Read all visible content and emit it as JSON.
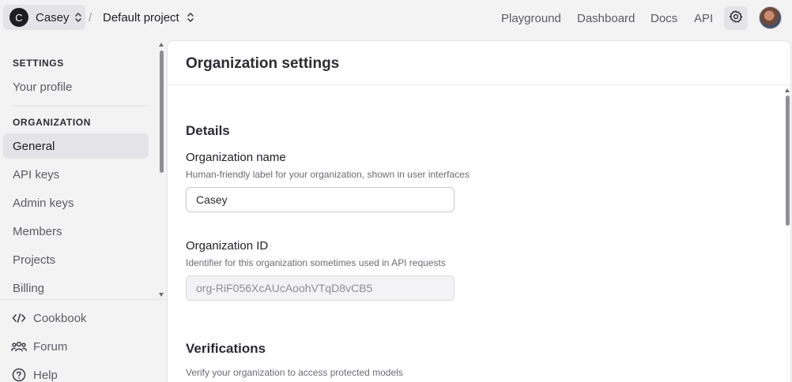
{
  "topbar": {
    "org_initial": "C",
    "org_name": "Casey",
    "separator": "/",
    "project_name": "Default project",
    "nav": [
      "Playground",
      "Dashboard",
      "Docs",
      "API"
    ]
  },
  "sidebar": {
    "settings_heading": "SETTINGS",
    "profile_label": "Your profile",
    "organization_heading": "ORGANIZATION",
    "items": [
      "General",
      "API keys",
      "Admin keys",
      "Members",
      "Projects",
      "Billing"
    ],
    "active_item": "General",
    "footer": [
      "Cookbook",
      "Forum",
      "Help"
    ]
  },
  "main": {
    "title": "Organization settings",
    "details_heading": "Details",
    "org_name_label": "Organization name",
    "org_name_help": "Human-friendly label for your organization, shown in user interfaces",
    "org_name_value": "Casey",
    "org_id_label": "Organization ID",
    "org_id_help": "Identifier for this organization sometimes used in API requests",
    "org_id_value": "org-RiF056XcAUcAoohVTqD8vCB5",
    "verifications_heading": "Verifications",
    "verifications_help": "Verify your organization to access protected models"
  },
  "colors": {
    "background": "#f3f3f4",
    "panel": "#ffffff",
    "active_item": "#e4e4e8",
    "text": "#2b2b33",
    "muted_text": "#5b5b63"
  },
  "icons": {
    "org_switch": "chevron-up-down-icon",
    "project_switch": "chevron-up-down-icon",
    "settings": "gear-icon",
    "cookbook": "code-icon",
    "forum": "users-icon",
    "help": "question-circle-icon"
  }
}
